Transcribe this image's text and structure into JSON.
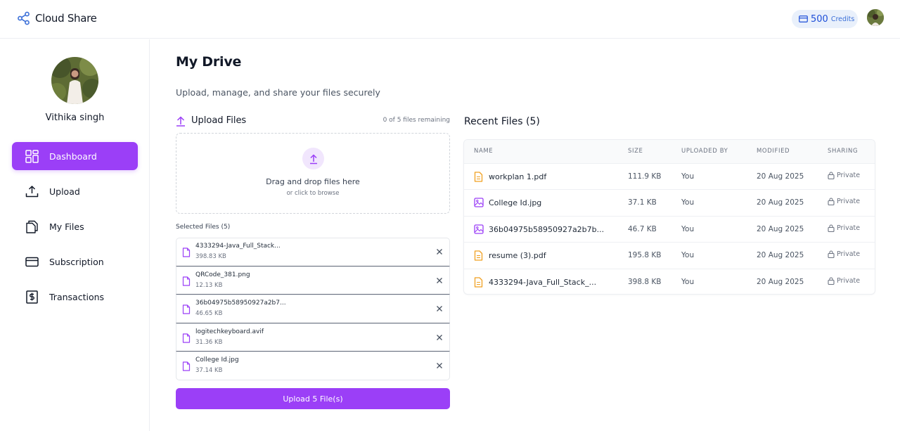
{
  "header": {
    "brand": "Cloud Share",
    "credits_value": "500",
    "credits_label": "Credits"
  },
  "sidebar": {
    "user_name": "Vithika singh",
    "items": [
      {
        "label": "Dashboard",
        "icon": "dashboard-grid-icon",
        "active": true
      },
      {
        "label": "Upload",
        "icon": "upload-icon"
      },
      {
        "label": "My Files",
        "icon": "files-icon"
      },
      {
        "label": "Subscription",
        "icon": "credit-card-icon"
      },
      {
        "label": "Transactions",
        "icon": "dollar-receipt-icon"
      }
    ]
  },
  "main": {
    "title": "My Drive",
    "subtitle": "Upload, manage, and share your files securely"
  },
  "upload": {
    "title": "Upload Files",
    "remaining": "0 of 5 files remaining",
    "drop_main": "Drag and drop files here",
    "drop_sub": "or click to browse",
    "selected_label": "Selected Files (5)",
    "selected_files": [
      {
        "name": "4333294-Java_Full_Stack...",
        "size": "398.83 KB"
      },
      {
        "name": "QRCode_381.png",
        "size": "12.13 KB"
      },
      {
        "name": "36b04975b58950927a2b7...",
        "size": "46.65 KB"
      },
      {
        "name": "logitechkeyboard.avif",
        "size": "31.36 KB"
      },
      {
        "name": "College Id.jpg",
        "size": "37.14 KB"
      }
    ],
    "button_label": "Upload 5 File(s)"
  },
  "recent": {
    "title": "Recent Files (5)",
    "columns": [
      "NAME",
      "SIZE",
      "UPLOADED BY",
      "MODIFIED",
      "SHARING"
    ],
    "rows": [
      {
        "name": "workplan 1.pdf",
        "type": "document",
        "size": "111.9 KB",
        "uploaded_by": "You",
        "modified": "20 Aug 2025",
        "sharing": "Private"
      },
      {
        "name": "College Id.jpg",
        "type": "image",
        "size": "37.1 KB",
        "uploaded_by": "You",
        "modified": "20 Aug 2025",
        "sharing": "Private"
      },
      {
        "name": "36b04975b58950927a2b7b...",
        "type": "image",
        "size": "46.7 KB",
        "uploaded_by": "You",
        "modified": "20 Aug 2025",
        "sharing": "Private"
      },
      {
        "name": "resume (3).pdf",
        "type": "document",
        "size": "195.8 KB",
        "uploaded_by": "You",
        "modified": "20 Aug 2025",
        "sharing": "Private"
      },
      {
        "name": "4333294-Java_Full_Stack_...",
        "type": "document",
        "size": "398.8 KB",
        "uploaded_by": "You",
        "modified": "20 Aug 2025",
        "sharing": "Private"
      }
    ]
  },
  "colors": {
    "accent": "#9b3ff7",
    "credits_text": "#1d4ed8",
    "doc_icon": "#f0a020",
    "image_icon": "#9b3ff7"
  }
}
